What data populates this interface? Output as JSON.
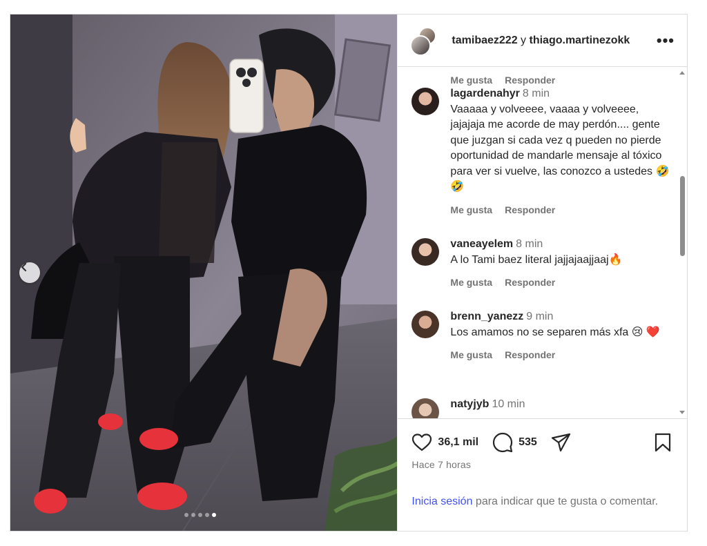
{
  "header": {
    "user1": "tamibaez222",
    "conjunction": "y",
    "user2": "thiago.martinezokk",
    "more_label": "•••"
  },
  "comments": [
    {
      "user": "",
      "time": "",
      "text": "",
      "like_label": "Me gusta",
      "reply_label": "Responder"
    },
    {
      "user": "lagardenahyr",
      "time": "8 min",
      "text": "Vaaaaa y volveeee, vaaaa y volveeee, jajajaja me acorde de may perdón.... gente que juzgan si cada vez q pueden no pierde oportunidad de mandarle mensaje al tóxico para ver si vuelve, las conozco a ustedes 🤣🤣",
      "like_label": "Me gusta",
      "reply_label": "Responder"
    },
    {
      "user": "vaneayelem",
      "time": "8 min",
      "text": "A lo Tami baez literal jajjajaajjaaj🔥",
      "like_label": "Me gusta",
      "reply_label": "Responder"
    },
    {
      "user": "brenn_yanezz",
      "time": "9 min",
      "text": "Los amamos no se separen más xfa 😢 ❤️",
      "like_label": "Me gusta",
      "reply_label": "Responder"
    },
    {
      "user": "natyjyb",
      "time": "10 min",
      "text": "",
      "like_label": "",
      "reply_label": ""
    }
  ],
  "footer": {
    "likes": "36,1 mil",
    "comments_count": "535",
    "time_ago": "Hace 7 horas",
    "login_link": "Inicia sesión",
    "login_rest": " para indicar que te gusta o comentar."
  },
  "carousel": {
    "total_slides": 5,
    "active_index": 4
  },
  "icons": {
    "prev": "chevron-left-icon",
    "like": "heart-icon",
    "comment": "comment-bubble-icon",
    "share": "send-icon",
    "save": "bookmark-icon",
    "more": "more-horizontal-icon"
  },
  "colors": {
    "link": "#4150f7",
    "muted": "#737373",
    "text": "#262626"
  }
}
